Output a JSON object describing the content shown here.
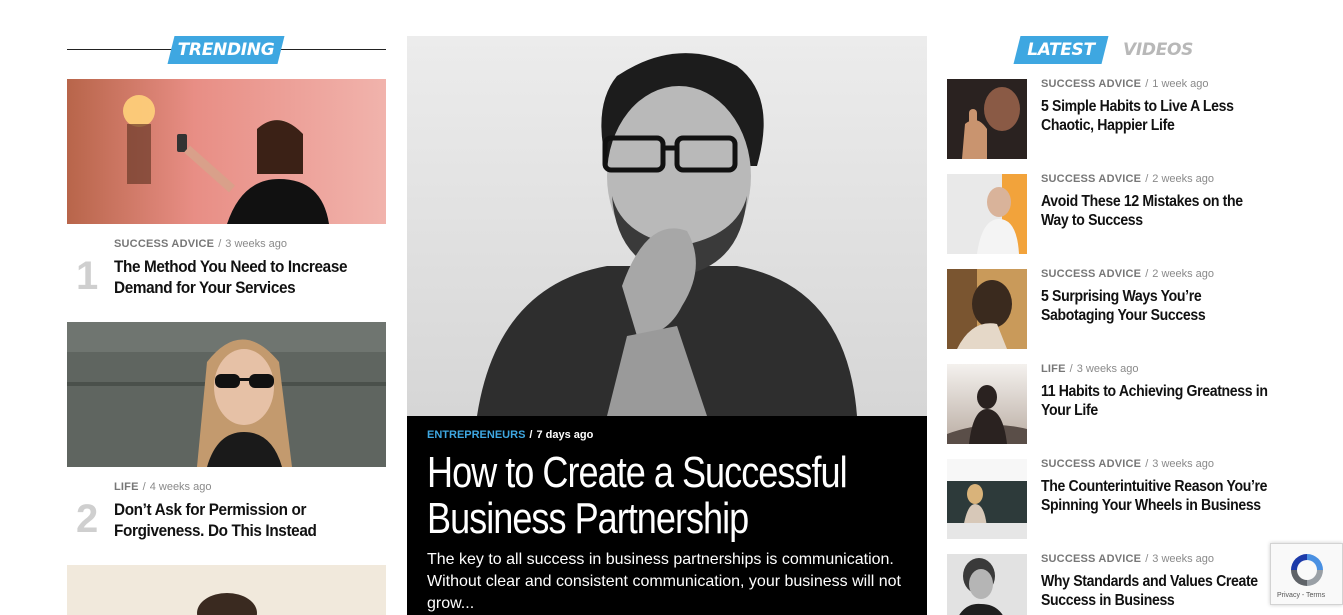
{
  "trending": {
    "label": "TRENDING",
    "items": [
      {
        "rank": "1",
        "category": "SUCCESS ADVICE",
        "time": "3 weeks ago",
        "title": "The Method You Need to Increase Demand for Your Services"
      },
      {
        "rank": "2",
        "category": "LIFE",
        "time": "4 weeks ago",
        "title": "Don’t Ask for Permission or Forgiveness. Do This Instead"
      }
    ]
  },
  "feature": {
    "category": "ENTREPRENEURS",
    "time": "7 days ago",
    "title": "How to Create a Successful Business Partnership",
    "excerpt": "The key to all success in business partnerships is communication. Without clear and consistent communication, your business will not grow..."
  },
  "tabs": {
    "active": "LATEST",
    "inactive": "VIDEOS"
  },
  "latest": [
    {
      "category": "SUCCESS ADVICE",
      "time": "1 week ago",
      "title": "5 Simple Habits to Live A Less Chaotic, Happier Life"
    },
    {
      "category": "SUCCESS ADVICE",
      "time": "2 weeks ago",
      "title": "Avoid These 12 Mistakes on the Way to Success"
    },
    {
      "category": "SUCCESS ADVICE",
      "time": "2 weeks ago",
      "title": "5 Surprising Ways You’re Sabotaging Your Success"
    },
    {
      "category": "LIFE",
      "time": "3 weeks ago",
      "title": "11 Habits to Achieving Greatness in Your Life"
    },
    {
      "category": "SUCCESS ADVICE",
      "time": "3 weeks ago",
      "title": "The Counterintuitive Reason You’re Spinning Your Wheels in Business"
    },
    {
      "category": "SUCCESS ADVICE",
      "time": "3 weeks ago",
      "title": "Why Standards and Values Create Success in Business"
    }
  ],
  "recaptcha": {
    "links": "Privacy - Terms"
  },
  "colors": {
    "accent": "#3ea7e1",
    "feature_bg": "#000000"
  }
}
